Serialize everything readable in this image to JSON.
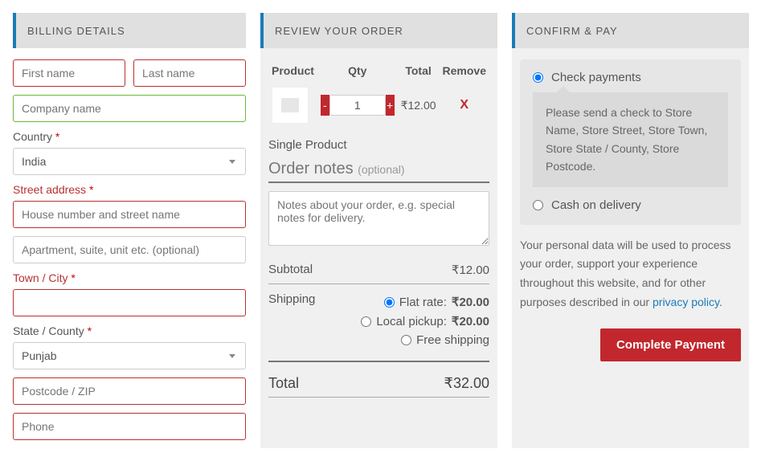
{
  "billing": {
    "heading": "BILLING DETAILS",
    "first_name_ph": "First name",
    "last_name_ph": "Last name",
    "company_ph": "Company name",
    "country_label": "Country",
    "country_value": "India",
    "street_label": "Street address",
    "street1_ph": "House number and street name",
    "street2_ph": "Apartment, suite, unit etc. (optional)",
    "town_label": "Town / City",
    "state_label": "State / County",
    "state_value": "Punjab",
    "postcode_ph": "Postcode / ZIP",
    "phone_ph": "Phone",
    "required_marker": "*"
  },
  "review": {
    "heading": "REVIEW YOUR ORDER",
    "th_product": "Product",
    "th_qty": "Qty",
    "th_total": "Total",
    "th_remove": "Remove",
    "qty_minus": "-",
    "qty_plus": "+",
    "qty_value": "1",
    "line_total": "₹12.00",
    "remove_x": "X",
    "product_name": "Single Product",
    "notes_title": "Order notes",
    "notes_optional": "(optional)",
    "notes_ph": "Notes about your order, e.g. special notes for delivery.",
    "subtotal_label": "Subtotal",
    "subtotal_value": "₹12.00",
    "shipping_label": "Shipping",
    "ship_flat": "Flat rate:",
    "ship_flat_price": "₹20.00",
    "ship_local": "Local pickup:",
    "ship_local_price": "₹20.00",
    "ship_free": "Free shipping",
    "total_label": "Total",
    "total_value": "₹32.00"
  },
  "confirm": {
    "heading": "CONFIRM & PAY",
    "check_label": "Check payments",
    "check_desc": "Please send a check to Store Name, Store Street, Store Town, Store State / County, Store Postcode.",
    "cod_label": "Cash on delivery",
    "privacy_text": "Your personal data will be used to process your order, support your experience throughout this website, and for other purposes described in our ",
    "privacy_link": "privacy policy",
    "privacy_dot": ".",
    "complete_btn": "Complete Payment"
  }
}
